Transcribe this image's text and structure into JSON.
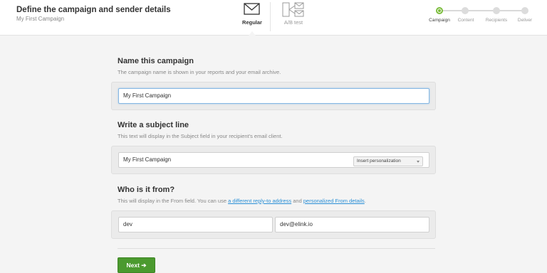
{
  "header": {
    "title": "Define the campaign and sender details",
    "subtitle": "My First Campaign",
    "tabs": [
      {
        "label": "Regular",
        "icon": "envelope-icon",
        "active": true
      },
      {
        "label": "A/B test",
        "icon": "ab-split-icon",
        "active": false
      }
    ]
  },
  "steps": [
    {
      "label": "Campaign",
      "active": true
    },
    {
      "label": "Content",
      "active": false
    },
    {
      "label": "Recipients",
      "active": false
    },
    {
      "label": "Deliver",
      "active": false
    }
  ],
  "name_section": {
    "title": "Name this campaign",
    "description": "The campaign name is shown in your reports and your email archive.",
    "value": "My First Campaign"
  },
  "subject_section": {
    "title": "Write a subject line",
    "description": "This text will display in the Subject field in your recipient's email client.",
    "value": "My First Campaign",
    "personalization_label": "Insert personalization"
  },
  "from_section": {
    "title": "Who is it from?",
    "desc_part1": "This will display in the From field. You can use",
    "link1": "a different reply-to address",
    "desc_part2": "and",
    "link2": "personalized From details",
    "desc_part3": ".",
    "from_name": "dev",
    "from_email": "dev@elink.io"
  },
  "actions": {
    "next_label": "Next ➔"
  },
  "colors": {
    "accent_green": "#4b9a2f",
    "step_active": "#7cbd3d",
    "link_blue": "#2a8fd6"
  }
}
